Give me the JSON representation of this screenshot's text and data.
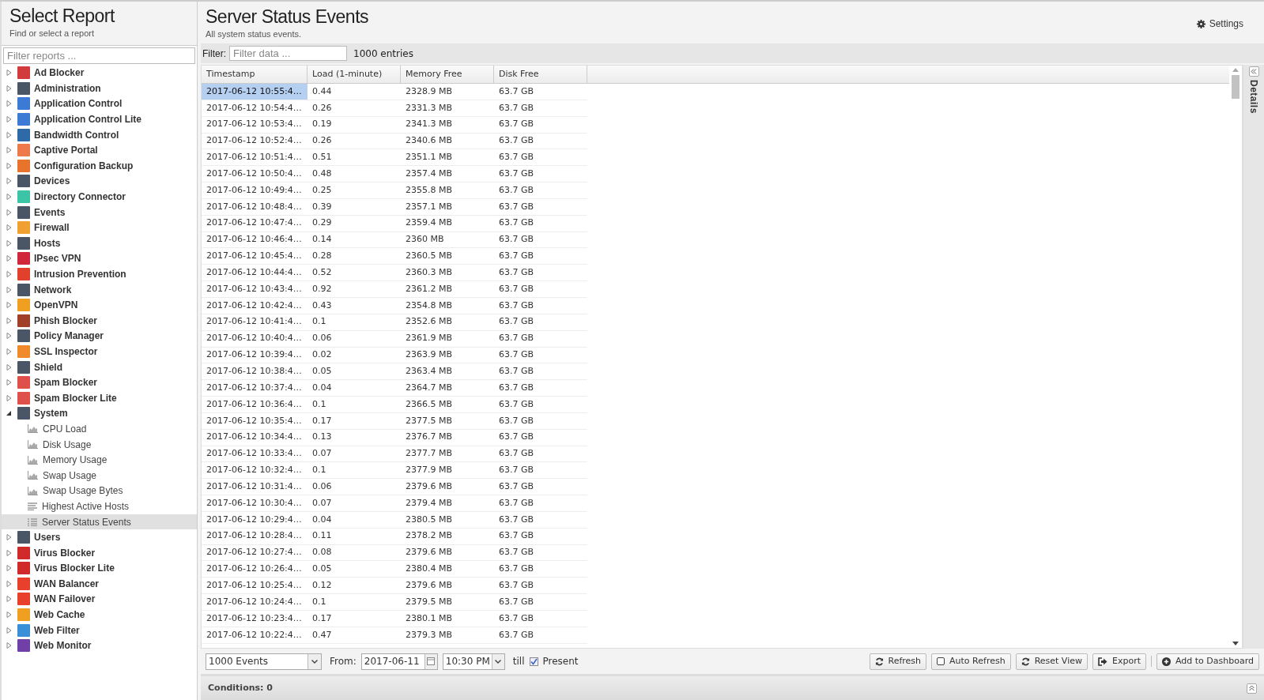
{
  "sidebar": {
    "title": "Select Report",
    "subtitle": "Find or select a report",
    "filter": {
      "placeholder": "Filter reports ..."
    },
    "items": [
      {
        "label": "Ad Blocker",
        "color": "#d23b3b",
        "expanded": false
      },
      {
        "label": "Administration",
        "color": "#4a5566",
        "expanded": false
      },
      {
        "label": "Application Control",
        "color": "#3b7bd6",
        "expanded": false
      },
      {
        "label": "Application Control Lite",
        "color": "#3b7bd6",
        "expanded": false
      },
      {
        "label": "Bandwidth Control",
        "color": "#2f6aa8",
        "expanded": false
      },
      {
        "label": "Captive Portal",
        "color": "#ee7a4a",
        "expanded": false
      },
      {
        "label": "Configuration Backup",
        "color": "#e8742c",
        "expanded": false
      },
      {
        "label": "Devices",
        "color": "#4a5566",
        "expanded": false
      },
      {
        "label": "Directory Connector",
        "color": "#3cc4a6",
        "expanded": false
      },
      {
        "label": "Events",
        "color": "#4a5566",
        "expanded": false
      },
      {
        "label": "Firewall",
        "color": "#f0a030",
        "expanded": false
      },
      {
        "label": "Hosts",
        "color": "#4a5566",
        "expanded": false
      },
      {
        "label": "IPsec VPN",
        "color": "#d0283a",
        "expanded": false
      },
      {
        "label": "Intrusion Prevention",
        "color": "#e0402c",
        "expanded": false
      },
      {
        "label": "Network",
        "color": "#4a5566",
        "expanded": false
      },
      {
        "label": "OpenVPN",
        "color": "#f0a020",
        "expanded": false
      },
      {
        "label": "Phish Blocker",
        "color": "#a04028",
        "expanded": false
      },
      {
        "label": "Policy Manager",
        "color": "#4a5566",
        "expanded": false
      },
      {
        "label": "SSL Inspector",
        "color": "#f08a2a",
        "expanded": false
      },
      {
        "label": "Shield",
        "color": "#4a5566",
        "expanded": false
      },
      {
        "label": "Spam Blocker",
        "color": "#e0504a",
        "expanded": false
      },
      {
        "label": "Spam Blocker Lite",
        "color": "#e0504a",
        "expanded": false
      },
      {
        "label": "System",
        "color": "#4a5566",
        "expanded": true,
        "children": [
          {
            "label": "CPU Load",
            "kind": "area",
            "selected": false
          },
          {
            "label": "Disk Usage",
            "kind": "area",
            "selected": false
          },
          {
            "label": "Memory Usage",
            "kind": "area",
            "selected": false
          },
          {
            "label": "Swap Usage",
            "kind": "area",
            "selected": false
          },
          {
            "label": "Swap Usage Bytes",
            "kind": "area",
            "selected": false
          },
          {
            "label": "Highest Active Hosts",
            "kind": "bars",
            "selected": false
          },
          {
            "label": "Server Status Events",
            "kind": "list",
            "selected": true
          }
        ]
      },
      {
        "label": "Users",
        "color": "#4a5566",
        "expanded": false
      },
      {
        "label": "Virus Blocker",
        "color": "#d02a2a",
        "expanded": false
      },
      {
        "label": "Virus Blocker Lite",
        "color": "#d02a2a",
        "expanded": false
      },
      {
        "label": "WAN Balancer",
        "color": "#e8402a",
        "expanded": false
      },
      {
        "label": "WAN Failover",
        "color": "#e8402a",
        "expanded": false
      },
      {
        "label": "Web Cache",
        "color": "#f0a020",
        "expanded": false
      },
      {
        "label": "Web Filter",
        "color": "#3a90d8",
        "expanded": false
      },
      {
        "label": "Web Monitor",
        "color": "#7040a8",
        "expanded": false
      }
    ]
  },
  "report": {
    "title": "Server Status Events",
    "subtitle": "All system status events.",
    "settings": "Settings"
  },
  "filter": {
    "label": "Filter:",
    "placeholder": "Filter data ...",
    "count": "1000 entries"
  },
  "table": {
    "columns": [
      "Timestamp",
      "Load (1-minute)",
      "Memory Free",
      "Disk Free"
    ],
    "rows": [
      {
        "cells": [
          "2017-06-12 10:55:4…",
          "0.44",
          "2328.9 MB",
          "63.7 GB"
        ],
        "selected": true
      },
      {
        "cells": [
          "2017-06-12 10:54:4…",
          "0.26",
          "2331.3 MB",
          "63.7 GB"
        ],
        "selected": false
      },
      {
        "cells": [
          "2017-06-12 10:53:4…",
          "0.19",
          "2341.3 MB",
          "63.7 GB"
        ],
        "selected": false
      },
      {
        "cells": [
          "2017-06-12 10:52:4…",
          "0.26",
          "2340.6 MB",
          "63.7 GB"
        ],
        "selected": false
      },
      {
        "cells": [
          "2017-06-12 10:51:4…",
          "0.51",
          "2351.1 MB",
          "63.7 GB"
        ],
        "selected": false
      },
      {
        "cells": [
          "2017-06-12 10:50:4…",
          "0.48",
          "2357.4 MB",
          "63.7 GB"
        ],
        "selected": false
      },
      {
        "cells": [
          "2017-06-12 10:49:4…",
          "0.25",
          "2355.8 MB",
          "63.7 GB"
        ],
        "selected": false
      },
      {
        "cells": [
          "2017-06-12 10:48:4…",
          "0.39",
          "2357.1 MB",
          "63.7 GB"
        ],
        "selected": false
      },
      {
        "cells": [
          "2017-06-12 10:47:4…",
          "0.29",
          "2359.4 MB",
          "63.7 GB"
        ],
        "selected": false
      },
      {
        "cells": [
          "2017-06-12 10:46:4…",
          "0.14",
          "2360 MB",
          "63.7 GB"
        ],
        "selected": false
      },
      {
        "cells": [
          "2017-06-12 10:45:4…",
          "0.28",
          "2360.5 MB",
          "63.7 GB"
        ],
        "selected": false
      },
      {
        "cells": [
          "2017-06-12 10:44:4…",
          "0.52",
          "2360.3 MB",
          "63.7 GB"
        ],
        "selected": false
      },
      {
        "cells": [
          "2017-06-12 10:43:4…",
          "0.92",
          "2361.2 MB",
          "63.7 GB"
        ],
        "selected": false
      },
      {
        "cells": [
          "2017-06-12 10:42:4…",
          "0.43",
          "2354.8 MB",
          "63.7 GB"
        ],
        "selected": false
      },
      {
        "cells": [
          "2017-06-12 10:41:4…",
          "0.1",
          "2352.6 MB",
          "63.7 GB"
        ],
        "selected": false
      },
      {
        "cells": [
          "2017-06-12 10:40:4…",
          "0.06",
          "2361.9 MB",
          "63.7 GB"
        ],
        "selected": false
      },
      {
        "cells": [
          "2017-06-12 10:39:4…",
          "0.02",
          "2363.9 MB",
          "63.7 GB"
        ],
        "selected": false
      },
      {
        "cells": [
          "2017-06-12 10:38:4…",
          "0.05",
          "2363.4 MB",
          "63.7 GB"
        ],
        "selected": false
      },
      {
        "cells": [
          "2017-06-12 10:37:4…",
          "0.04",
          "2364.7 MB",
          "63.7 GB"
        ],
        "selected": false
      },
      {
        "cells": [
          "2017-06-12 10:36:4…",
          "0.1",
          "2366.5 MB",
          "63.7 GB"
        ],
        "selected": false
      },
      {
        "cells": [
          "2017-06-12 10:35:4…",
          "0.17",
          "2377.5 MB",
          "63.7 GB"
        ],
        "selected": false
      },
      {
        "cells": [
          "2017-06-12 10:34:4…",
          "0.13",
          "2376.7 MB",
          "63.7 GB"
        ],
        "selected": false
      },
      {
        "cells": [
          "2017-06-12 10:33:4…",
          "0.07",
          "2377.7 MB",
          "63.7 GB"
        ],
        "selected": false
      },
      {
        "cells": [
          "2017-06-12 10:32:4…",
          "0.1",
          "2377.9 MB",
          "63.7 GB"
        ],
        "selected": false
      },
      {
        "cells": [
          "2017-06-12 10:31:4…",
          "0.06",
          "2379.6 MB",
          "63.7 GB"
        ],
        "selected": false
      },
      {
        "cells": [
          "2017-06-12 10:30:4…",
          "0.07",
          "2379.4 MB",
          "63.7 GB"
        ],
        "selected": false
      },
      {
        "cells": [
          "2017-06-12 10:29:4…",
          "0.04",
          "2380.5 MB",
          "63.7 GB"
        ],
        "selected": false
      },
      {
        "cells": [
          "2017-06-12 10:28:4…",
          "0.11",
          "2378.2 MB",
          "63.7 GB"
        ],
        "selected": false
      },
      {
        "cells": [
          "2017-06-12 10:27:4…",
          "0.08",
          "2379.6 MB",
          "63.7 GB"
        ],
        "selected": false
      },
      {
        "cells": [
          "2017-06-12 10:26:4…",
          "0.05",
          "2380.4 MB",
          "63.7 GB"
        ],
        "selected": false
      },
      {
        "cells": [
          "2017-06-12 10:25:4…",
          "0.12",
          "2379.6 MB",
          "63.7 GB"
        ],
        "selected": false
      },
      {
        "cells": [
          "2017-06-12 10:24:4…",
          "0.1",
          "2379.5 MB",
          "63.7 GB"
        ],
        "selected": false
      },
      {
        "cells": [
          "2017-06-12 10:23:4…",
          "0.17",
          "2380.1 MB",
          "63.7 GB"
        ],
        "selected": false
      },
      {
        "cells": [
          "2017-06-12 10:22:4…",
          "0.47",
          "2379.3 MB",
          "63.7 GB"
        ],
        "selected": false
      }
    ]
  },
  "details": {
    "label": "Details"
  },
  "toolbar": {
    "limit": "1000 Events",
    "from_label": "From:",
    "from_date": "2017-06-11",
    "from_time": "10:30 PM",
    "till_label": "till",
    "present": {
      "label": "Present",
      "checked": true
    },
    "buttons": [
      {
        "label": "Refresh",
        "kind": "refresh"
      },
      {
        "label": "Auto Refresh",
        "kind": "checkbox",
        "checked": false
      },
      {
        "label": "Reset View",
        "kind": "refresh"
      },
      {
        "label": "Export",
        "kind": "export"
      },
      {
        "label": "Add to Dashboard",
        "kind": "add"
      }
    ]
  },
  "conditions": {
    "label": "Conditions: 0"
  }
}
